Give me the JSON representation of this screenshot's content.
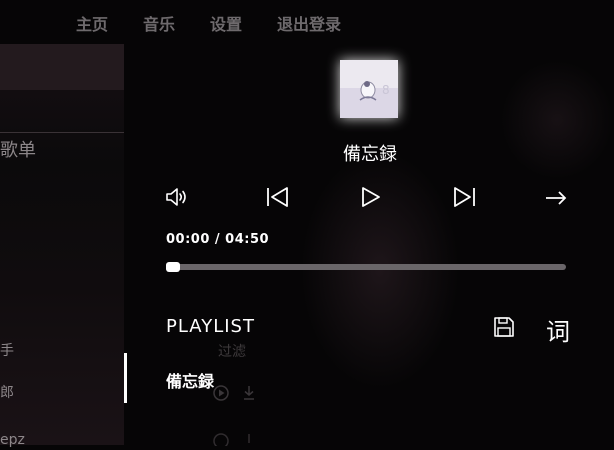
{
  "nav": {
    "items": [
      "主页",
      "音乐",
      "设置",
      "退出登录"
    ]
  },
  "background": {
    "left_heading": "歌单",
    "left_items": [
      "手",
      "郎",
      "epz"
    ],
    "filter_label": "过滤"
  },
  "player": {
    "song_title": "備忘録",
    "time": "00:00 / 04:50",
    "progress": 0.01,
    "controls": {
      "volume": "volume-icon",
      "previous": "skip-previous-icon",
      "play": "play-icon",
      "next": "skip-next-icon",
      "mode": "arrow-right-icon"
    }
  },
  "playlist": {
    "title": "PLAYLIST",
    "save_icon": "save-icon",
    "lyrics_label": "词",
    "items": [
      "備忘録"
    ]
  }
}
